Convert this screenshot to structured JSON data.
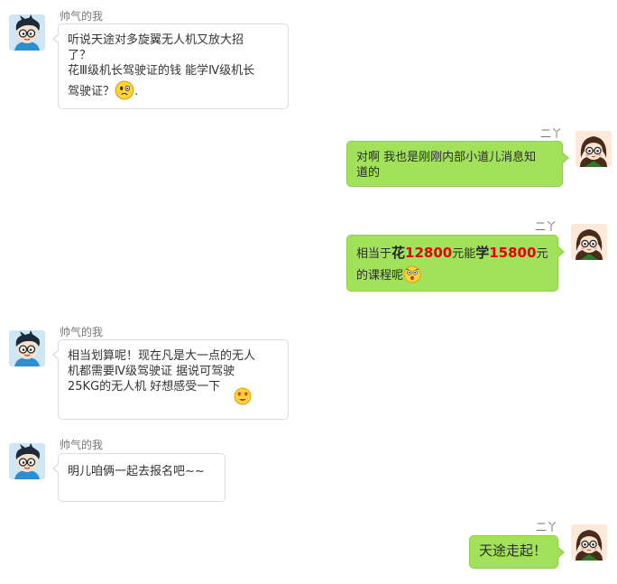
{
  "contacts": {
    "left_name": "帅气的我",
    "right_name": "二丫"
  },
  "messages": [
    {
      "sender": "帅气的我",
      "lines": [
        "听说天途对多旋翼无人机又放大招",
        "了？",
        "花Ⅲ级机长驾驶证的钱 能学Ⅳ级机长",
        "驾驶证？"
      ],
      "trailing": ".",
      "emoji": "confused-face-icon"
    },
    {
      "sender": "二丫",
      "lines": [
        "对啊 我也是刚刚内部小道儿消息知",
        "道的"
      ]
    },
    {
      "sender": "二丫",
      "parts": [
        "相当于",
        "花",
        "12800",
        "元能",
        "学",
        "15800",
        "元"
      ],
      "line2": "的课程呢",
      "emoji": "shocked-face-icon"
    },
    {
      "sender": "帅气的我",
      "lines": [
        "相当划算呢！现在凡是大一点的无人",
        "机都需要Ⅳ级驾驶证 据说可驾驶",
        "25KG的无人机 好想感受一下"
      ],
      "emoji": "heart-eyes-face-icon"
    },
    {
      "sender": "帅气的我",
      "lines": [
        "明儿咱俩一起去报名吧~~"
      ]
    },
    {
      "sender": "二丫",
      "lines": [
        "天途走起！"
      ]
    }
  ],
  "colors": {
    "left_bubble": "#ffffff",
    "right_bubble": "#a2e25a",
    "price_highlight": "#e60000"
  }
}
